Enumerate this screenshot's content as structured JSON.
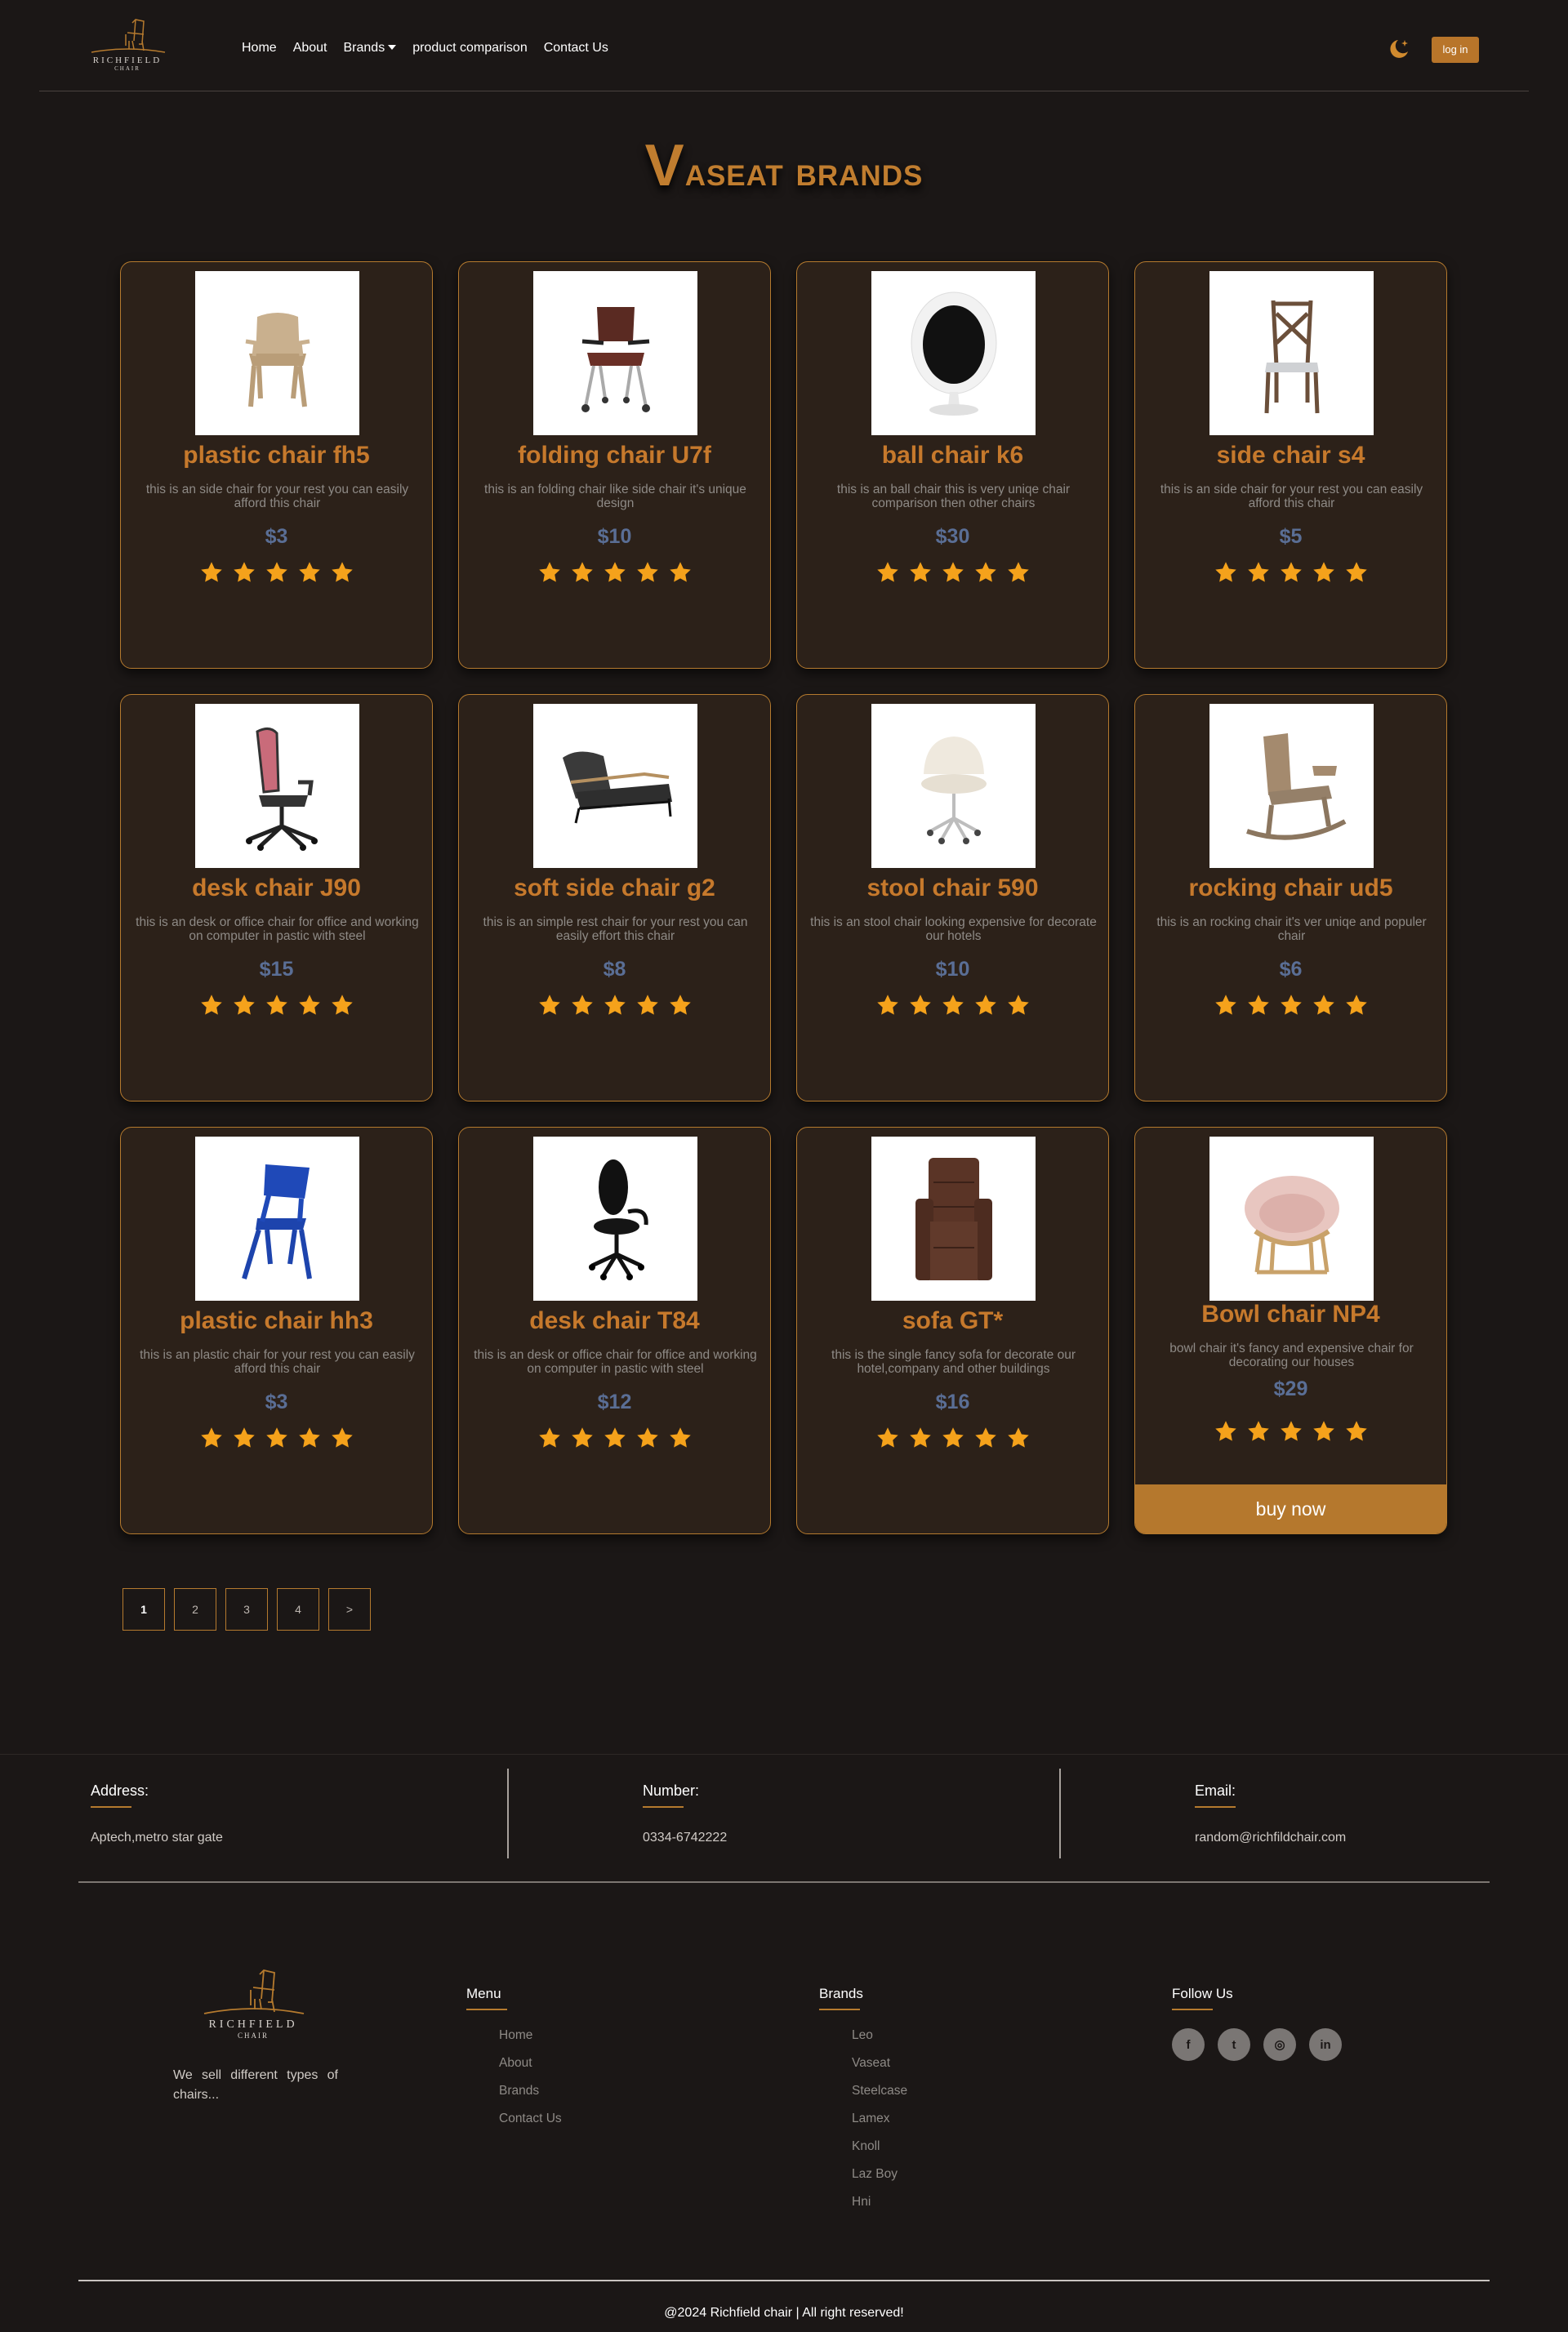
{
  "brand": {
    "line1": "RICHFIELD",
    "line2": "CHAIR"
  },
  "nav": {
    "home": "Home",
    "about": "About",
    "brands": "Brands",
    "comparison": "product comparison",
    "contact": "Contact Us"
  },
  "header": {
    "login_label": "log in"
  },
  "page": {
    "title_cap": "V",
    "title_rest": "aseat brands"
  },
  "products": [
    {
      "name": "plastic chair fh5",
      "desc": "this is an side chair for your rest you can easily afford this chair",
      "price": "$3",
      "rating": 5
    },
    {
      "name": "folding chair U7f",
      "desc": "this is an folding chair like side chair it's unique design",
      "price": "$10",
      "rating": 5
    },
    {
      "name": "ball chair k6",
      "desc": "this is an ball chair this is very uniqe chair comparison then other chairs",
      "price": "$30",
      "rating": 5
    },
    {
      "name": "side chair s4",
      "desc": "this is an side chair for your rest you can easily afford this chair",
      "price": "$5",
      "rating": 5
    },
    {
      "name": "desk chair J90",
      "desc": "this is an desk or office chair for office and working on computer in pastic with steel",
      "price": "$15",
      "rating": 5
    },
    {
      "name": "soft side chair g2",
      "desc": "this is an simple rest chair for your rest you can easily effort this chair",
      "price": "$8",
      "rating": 5
    },
    {
      "name": "stool chair 590",
      "desc": "this is an stool chair looking expensive for decorate our hotels",
      "price": "$10",
      "rating": 5
    },
    {
      "name": "rocking chair ud5",
      "desc": "this is an rocking chair it's ver uniqe and populer chair",
      "price": "$6",
      "rating": 5
    },
    {
      "name": "plastic chair hh3",
      "desc": "this is an plastic chair for your rest you can easily afford this chair",
      "price": "$3",
      "rating": 5
    },
    {
      "name": "desk chair T84",
      "desc": "this is an desk or office chair for office and working on computer in pastic with steel",
      "price": "$12",
      "rating": 5
    },
    {
      "name": "sofa GT*",
      "desc": "this is the single fancy sofa for decorate our hotel,company and other buildings",
      "price": "$16",
      "rating": 5
    },
    {
      "name": "Bowl chair NP4",
      "desc": "bowl chair it's fancy and expensive chair for decorating our houses",
      "price": "$29",
      "rating": 5,
      "buy_label": "buy now"
    }
  ],
  "pagination": [
    "1",
    "2",
    "3",
    "4",
    ">"
  ],
  "contact": {
    "address_label": "Address:",
    "address": "Aptech,metro star gate",
    "number_label": "Number:",
    "number": "0334-6742222",
    "email_label": "Email:",
    "email": "random@richfildchair.com"
  },
  "footer": {
    "tagline": "We sell different types of chairs...",
    "menu_title": "Menu",
    "menu": [
      "Home",
      "About",
      "Brands",
      "Contact Us"
    ],
    "brands_title": "Brands",
    "brands": [
      "Leo",
      "Vaseat",
      "Steelcase",
      "Lamex",
      "Knoll",
      "Laz Boy",
      "Hni"
    ],
    "follow_title": "Follow Us",
    "socials": {
      "facebook": "f",
      "twitter": "t",
      "instagram": "◎",
      "linkedin": "in"
    },
    "copyright": "@2024 Richfield chair | All right reserved!"
  },
  "colors": {
    "accent": "#b57a2e",
    "title": "#c07d2f",
    "price": "#5a6e95",
    "star": "#f5a21b",
    "background": "#1b1716",
    "card": "#2c2119"
  }
}
